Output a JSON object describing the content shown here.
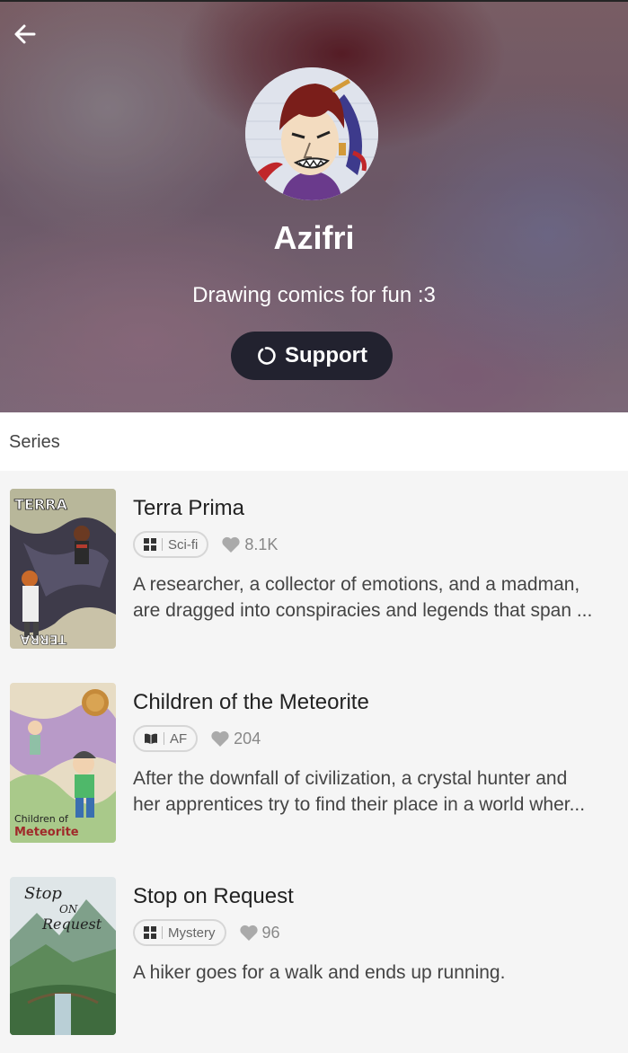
{
  "profile": {
    "name": "Azifri",
    "tagline": "Drawing comics for fun :3",
    "support_label": "Support"
  },
  "icons": {
    "back": "arrow-left-icon",
    "support": "support-ring-icon",
    "genre_grid": "layout-grid-icon",
    "genre_book": "open-book-icon",
    "likes": "heart-icon"
  },
  "section": {
    "label": "Series"
  },
  "series": [
    {
      "title": "Terra Prima",
      "genre": "Sci-fi",
      "genre_icon": "layout-grid-icon",
      "likes": "8.1K",
      "desc_line1": "A researcher, a collector of emotions, and a madman,",
      "desc_line2": "are dragged into conspiracies and legends that span ..."
    },
    {
      "title": "Children of the Meteorite",
      "genre": "AF",
      "genre_icon": "open-book-icon",
      "likes": "204",
      "desc_line1": "After the downfall of civilization, a crystal hunter and",
      "desc_line2": "her apprentices try to find their place in a world wher..."
    },
    {
      "title": "Stop on Request",
      "genre": "Mystery",
      "genre_icon": "layout-grid-icon",
      "likes": "96",
      "desc_line1": "A hiker goes for a walk and ends up running.",
      "desc_line2": ""
    }
  ],
  "colors": {
    "support_button_bg": "#22222f",
    "page_bg": "#f5f5f5"
  }
}
